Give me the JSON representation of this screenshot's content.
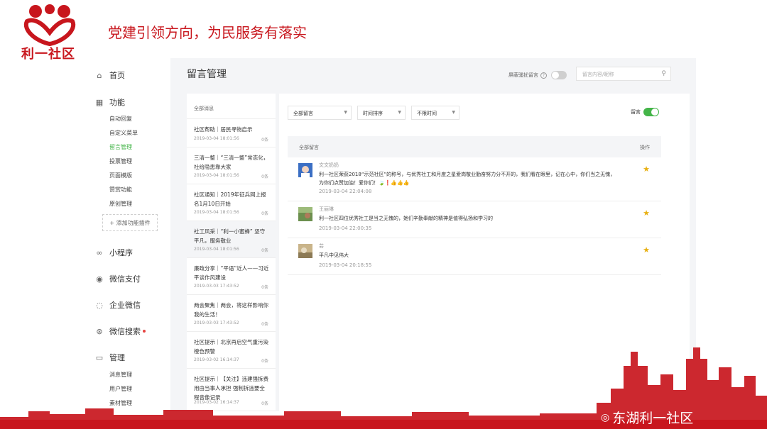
{
  "slide": {
    "logo_text": "利一社区",
    "title": "党建引领方向，为民服务有落实",
    "brand": "东湖利一社区",
    "brand_color": "#c8161d"
  },
  "nav": {
    "home": "首页",
    "functions": "功能",
    "function_items": [
      "自动回复",
      "自定义菜单",
      "留言管理",
      "投票管理",
      "页面模版",
      "赞赏功能",
      "原创管理"
    ],
    "active_item": "留言管理",
    "add_plugin": "+ 添加功能插件",
    "miniprogram": "小程序",
    "wechat_pay": "微信支付",
    "work_wechat": "企业微信",
    "wechat_search": "微信搜索",
    "manage": "管理",
    "manage_items": [
      "消息管理",
      "用户管理",
      "素材管理"
    ],
    "accent_color": "#44b549"
  },
  "page": {
    "title": "留言管理",
    "filter_label": "屏蔽骚扰留言",
    "search_placeholder": "留言内容/昵称"
  },
  "articles": {
    "header": "全部消息",
    "items": [
      {
        "title": "社区帮助｜居民寻物启示",
        "date": "2019-03-04 18:01:56",
        "count": "0条"
      },
      {
        "title": "三清一整｜“三清一整”常态化，社给隐患靠大家",
        "date": "2019-03-04 18:01:56",
        "count": "0条"
      },
      {
        "title": "社区通知｜2019年征兵网上报名1月10日开始",
        "date": "2019-03-04 18:01:56",
        "count": "0条"
      },
      {
        "title": "社工风采｜“利一小蜜蜂” 坚守平凡，服务敬业",
        "date": "2019-03-04 18:01:56",
        "count": "0条"
      },
      {
        "title": "廉政分享｜“平语”近人——习近平谈作风建设",
        "date": "2019-03-03 17:43:52",
        "count": "0条"
      },
      {
        "title": "两会聚焦｜两会，将这样影响你我的生活！",
        "date": "2019-03-03 17:43:52",
        "count": "0条"
      },
      {
        "title": "社区提示｜北京再启空气重污染橙色预警",
        "date": "2019-03-02 16:14:37",
        "count": "0条"
      },
      {
        "title": "社区提示｜【关注】违建强拆费用由当事人承担 强制拆违要全程音像记录",
        "date": "2019-03-02 16:14:37",
        "count": "0条"
      }
    ]
  },
  "panel": {
    "dropdowns": [
      "全部留言",
      "时间排序",
      "不限时间"
    ],
    "toggle_label": "留言",
    "table_header_left": "全部留言",
    "table_header_right": "操作",
    "comments": [
      {
        "name": "文文奶奶",
        "text": "利一社区荣获2018“示范社区”的称号，与优秀社工和月度之星爱岗敬业勤奋努力分不开的，我们看在眼里，记在心中，你们当之无愧，为你们点赞加油！爱你们！🍃❗👍👍👍",
        "time": "2019-03-04 22:04:08"
      },
      {
        "name": "王丽琳",
        "text": "利一社区四位优秀社工是当之无愧的，她们辛勤奉献的精神是值得弘扬和学习的",
        "time": "2019-03-04 22:00:35"
      },
      {
        "name": "芸",
        "text": "平凡中见伟大",
        "time": "2019-03-04 20:18:55"
      }
    ],
    "star_color": "#e8b012"
  }
}
